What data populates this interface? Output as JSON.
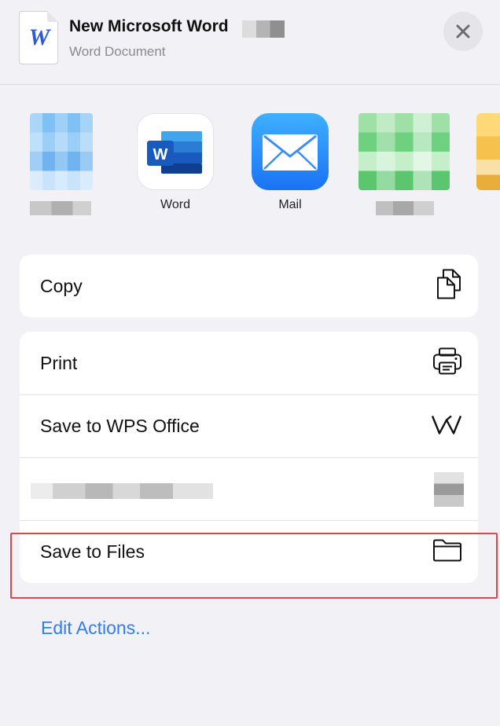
{
  "header": {
    "doc_icon_letter": "W",
    "title": "New Microsoft Word",
    "subtitle": "Word Document",
    "close_icon": "close-icon"
  },
  "apps": [
    {
      "label": "",
      "icon": "blurred-app-icon"
    },
    {
      "label": "Word",
      "icon": "microsoft-word-icon"
    },
    {
      "label": "Mail",
      "icon": "mail-icon"
    },
    {
      "label": "",
      "icon": "blurred-app-icon"
    }
  ],
  "actions": {
    "copy": {
      "label": "Copy",
      "icon": "copy-icon"
    },
    "print": {
      "label": "Print",
      "icon": "printer-icon"
    },
    "wps": {
      "label": "Save to WPS Office",
      "icon": "wps-office-icon"
    },
    "save_files": {
      "label": "Save to Files",
      "icon": "folder-icon"
    }
  },
  "edit_actions": "Edit Actions...",
  "colors": {
    "accent": "#2f7cf6",
    "highlight": "#e34545",
    "background": "#f2f2f6"
  }
}
